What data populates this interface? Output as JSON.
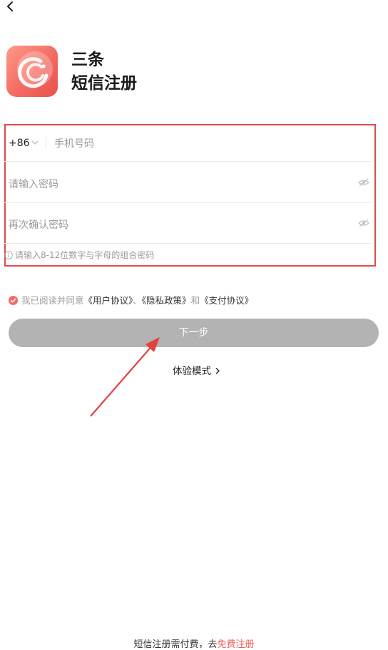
{
  "header": {
    "back_icon": "chevron-left-icon"
  },
  "app": {
    "name": "三条",
    "logo_icon": "app-logo-icon",
    "brand_color": "#f36b62"
  },
  "page": {
    "title": "短信注册"
  },
  "form": {
    "country_code": "+86",
    "phone_placeholder": "手机号码",
    "password_placeholder": "请输入密码",
    "confirm_placeholder": "再次确认密码",
    "hint": "请输入8-12位数字与字母的组合密码",
    "highlight_color": "#e04a4a"
  },
  "agreement": {
    "prefix": "我已阅读并同意",
    "user_agreement": "《用户协议》",
    "sep1": "、",
    "privacy_policy": "《隐私政策》",
    "and": "和",
    "payment_agreement": "《支付协议》",
    "checked": true
  },
  "actions": {
    "next_label": "下一步",
    "trial_label": "体验模式"
  },
  "footer": {
    "text": "短信注册需付费，去",
    "free_link": "免费注册",
    "link_color": "#f05b55"
  }
}
